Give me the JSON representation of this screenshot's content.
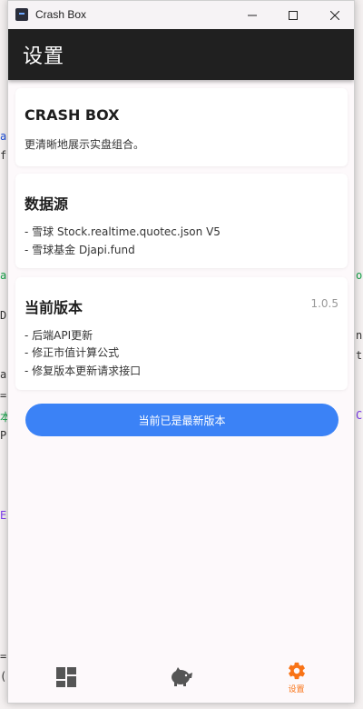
{
  "window": {
    "title": "Crash Box"
  },
  "header": {
    "title": "设置"
  },
  "cards": {
    "about": {
      "title": "CRASH BOX",
      "description": "更清晰地展示实盘组合。"
    },
    "data_source": {
      "title": "数据源",
      "lines": [
        "- 雪球  Stock.realtime.quotec.json V5",
        "- 雪球基金  Djapi.fund"
      ]
    },
    "version": {
      "title": "当前版本",
      "number": "1.0.5",
      "lines": [
        "- 后端API更新",
        "- 修正市值计算公式",
        "- 修复版本更新请求接口"
      ]
    }
  },
  "update_button": {
    "label": "当前已是最新版本"
  },
  "tabbar": {
    "items": [
      {
        "icon": "dashboard-icon",
        "label": ""
      },
      {
        "icon": "piggy-bank-icon",
        "label": ""
      },
      {
        "icon": "gear-icon",
        "label": "设置"
      }
    ],
    "active_color": "#f97316",
    "inactive_color": "#555555"
  },
  "colors": {
    "header_bg": "#202020",
    "accent": "#3b82f6"
  }
}
